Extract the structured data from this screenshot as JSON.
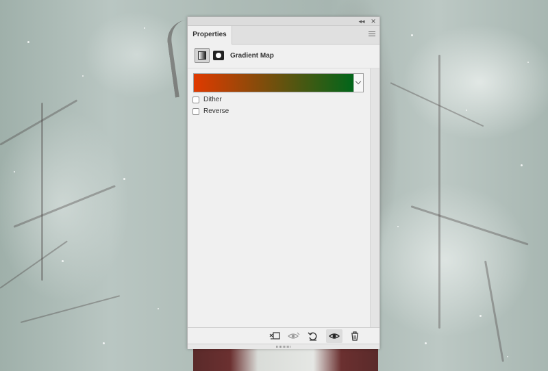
{
  "panel": {
    "tab_label": "Properties",
    "adjustment_title": "Gradient Map",
    "gradient": {
      "start_color": "#e03a00",
      "end_color": "#00661a"
    },
    "dither": {
      "label": "Dither",
      "checked": false
    },
    "reverse": {
      "label": "Reverse",
      "checked": false
    }
  },
  "colors": {
    "panel_bg": "#f0f0f0",
    "title_text": "#333333"
  }
}
